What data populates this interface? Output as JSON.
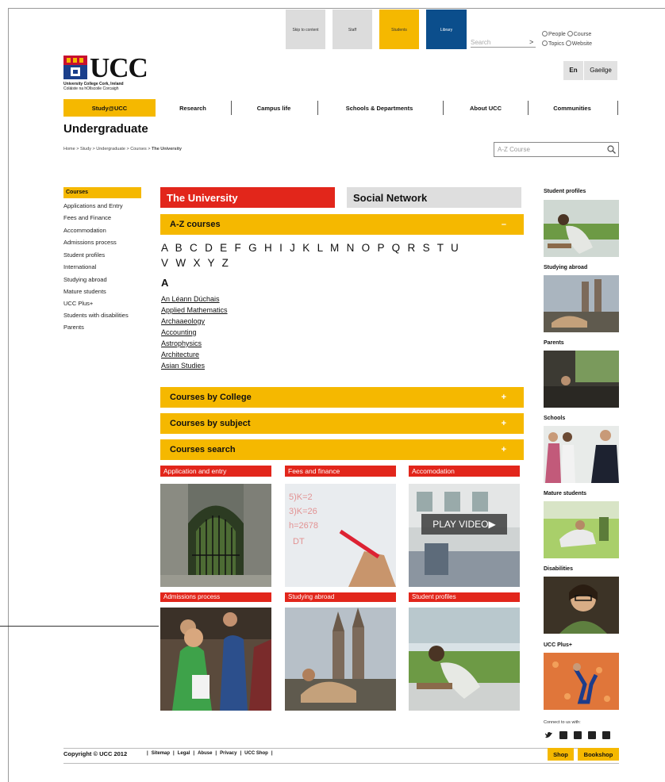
{
  "colors": {
    "accent_yellow": "#f5b800",
    "accent_red": "#e2261b",
    "library_blue": "#0b4e8c"
  },
  "topbar": {
    "tabs": [
      {
        "label": "Skip to content",
        "bg": "#dcdcdc"
      },
      {
        "label": "Staff",
        "bg": "#dcdcdc"
      },
      {
        "label": "Students",
        "bg": "#f5b800"
      },
      {
        "label": "Library",
        "bg": "#0b4e8c"
      }
    ],
    "search_placeholder": "Search",
    "search_go": ">",
    "radios": [
      "People",
      "Course",
      "Topics",
      "Website"
    ]
  },
  "logo": {
    "text": "UCC",
    "sub1": "University College Cork, Ireland",
    "sub2": "Coláiste na hOllscoile Corcaigh"
  },
  "lang": {
    "en": "En",
    "ga": "Gaeilge"
  },
  "nav": [
    "Study@UCC",
    "Research",
    "Campus life",
    "Schools & Departments",
    "About UCC",
    "Communities"
  ],
  "page_title": "Undergraduate",
  "breadcrumb": {
    "path": "Home > Study > Undergraduate > Courses > ",
    "current": "The University"
  },
  "az_search_placeholder": "A-Z Course",
  "sidebar": {
    "heading": "Courses",
    "items": [
      "Applications and Entry",
      "Fees and Finance",
      "Accommodation",
      "Admissions process",
      "Student profiles",
      "International",
      "Studying abroad",
      "Mature students",
      "UCC Plus+",
      "Students with disabilities",
      "Parents"
    ]
  },
  "tabs": {
    "active": "The University",
    "inactive": "Social Network"
  },
  "accordions": [
    {
      "label": "A-Z courses",
      "sign": "–"
    },
    {
      "label": "Courses by College",
      "sign": "+"
    },
    {
      "label": "Courses by subject",
      "sign": "+"
    },
    {
      "label": "Courses search",
      "sign": "+"
    }
  ],
  "letters_line1": "A B C D E F G H I J K L M N O P Q R S T U",
  "letters_line2": "V W X Y Z",
  "letter_head": "A",
  "courses": [
    "An Léann Dúchais",
    "Applied Mathematics",
    "Archaaeology",
    "Accounting",
    "Astrophysics",
    "Architecture",
    "Asian Studies"
  ],
  "tiles": [
    {
      "label": "Application and entry",
      "icon": "gate-photo"
    },
    {
      "label": "Fees and finance",
      "icon": "whiteboard-photo"
    },
    {
      "label": "Accomodation",
      "icon": "video-photo"
    },
    {
      "label": "Admissions process",
      "icon": "students-photo"
    },
    {
      "label": "Studying abroad",
      "icon": "church-photo"
    },
    {
      "label": "Student profiles",
      "icon": "reading-photo"
    }
  ],
  "play_video": "PLAY VIDEO▶",
  "rail": [
    "Student profiles",
    "Studying abroad",
    "Parents",
    "Schools",
    "Mature students",
    "Disabilities",
    "UCC Plus+"
  ],
  "connect": "Connect to us with:",
  "footer": {
    "copyright": "Copyright © UCC 2012",
    "links": [
      "Sitemap",
      "Legal",
      "Abuse",
      "Privacy",
      "UCC Shop"
    ],
    "shop": "Shop",
    "bookshop": "Bookshop"
  }
}
